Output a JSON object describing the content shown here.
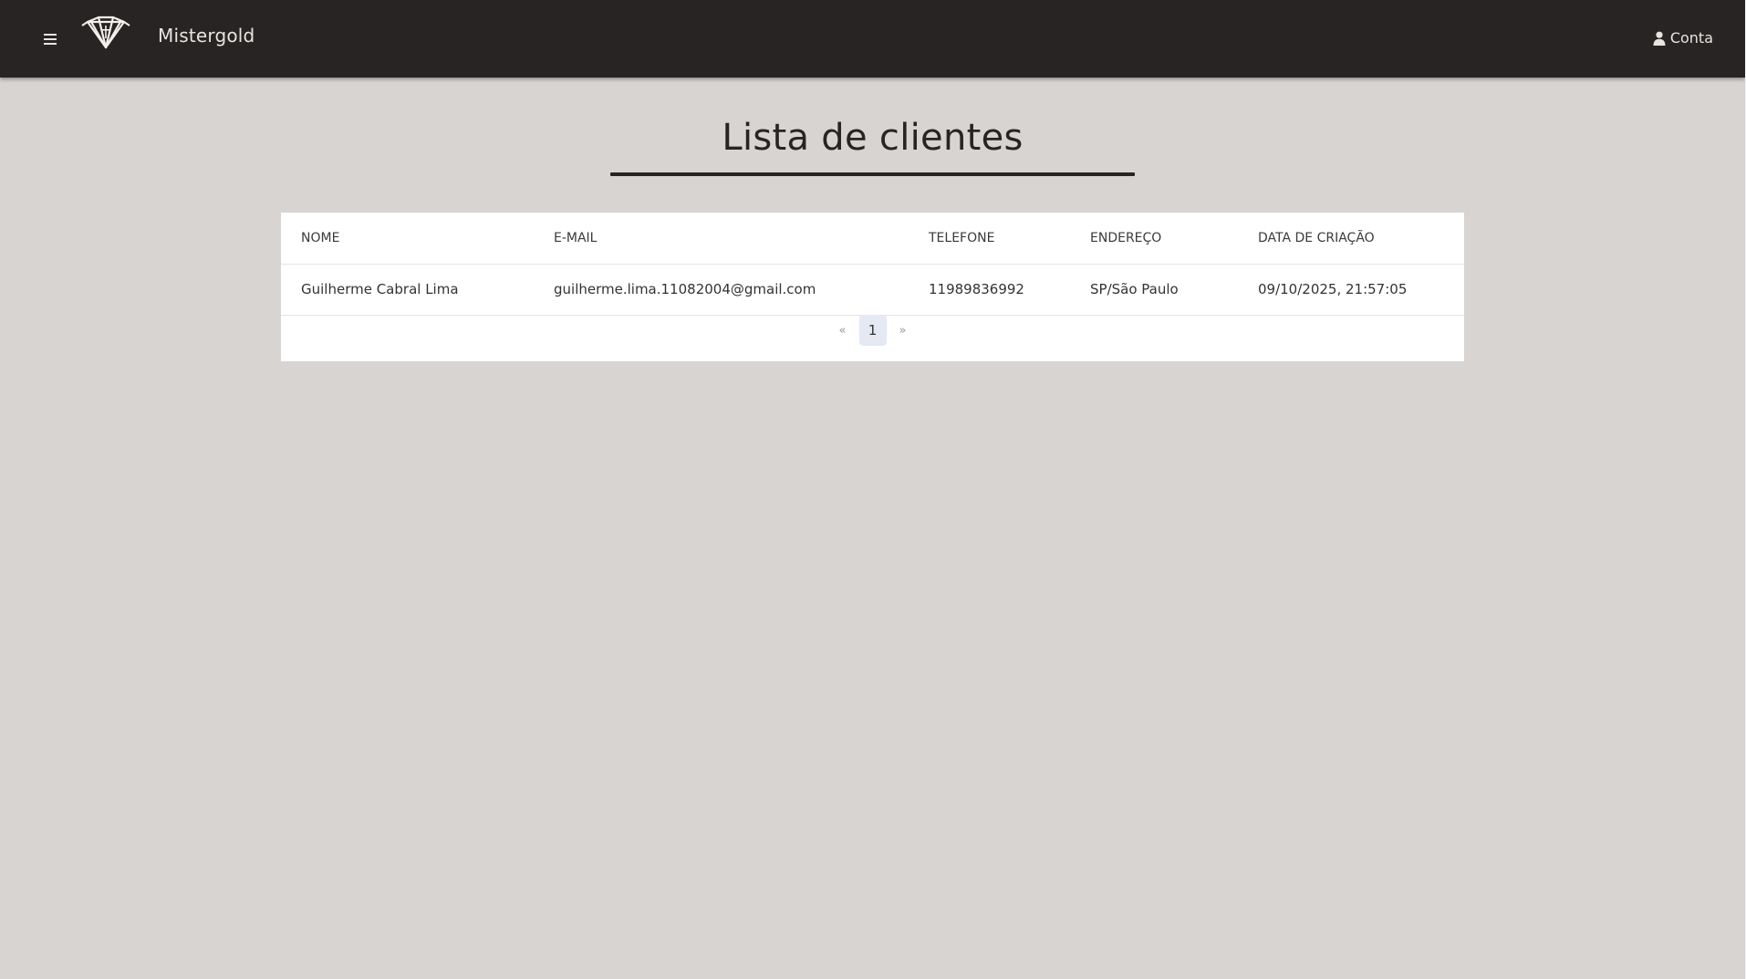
{
  "header": {
    "brand": "Mistergold",
    "account_label": "Conta",
    "menu_icon": "hamburger-menu-icon",
    "logo_icon": "diamond-logo-icon",
    "account_icon": "user-icon",
    "background_color": "#282423"
  },
  "main": {
    "title": "Lista de clientes",
    "table": {
      "columns": [
        "NOME",
        "E-MAIL",
        "TELEFONE",
        "ENDEREÇO",
        "DATA DE CRIAÇÃO"
      ],
      "rows": [
        {
          "nome": "Guilherme Cabral Lima",
          "email": "guilherme.lima.11082004@gmail.com",
          "telefone": "11989836992",
          "endereco": "SP/São Paulo",
          "data_criacao": "09/10/2025, 21:57:05"
        }
      ]
    },
    "pagination": {
      "prev": "«",
      "current_page": "1",
      "next": "»"
    }
  },
  "colors": {
    "page_background": "#d8d4d1",
    "accent_dark": "#282423",
    "active_page_background": "#e4e9f4"
  }
}
